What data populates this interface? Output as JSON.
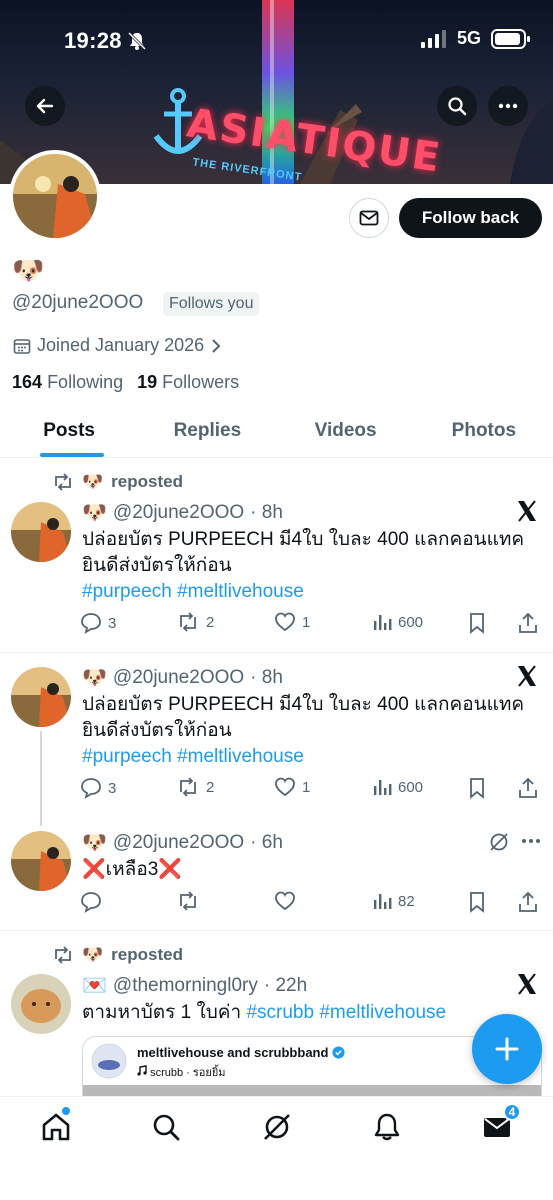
{
  "status_bar": {
    "time": "19:28",
    "network": "5G"
  },
  "banner": {
    "sign_text": "ASIATIQUE",
    "sign_subtext": "THE RIVERFRONT"
  },
  "profile": {
    "display_name": "🐶",
    "handle": "@20june2OOO",
    "follows_you": "Follows you",
    "joined": "Joined January 2026",
    "following_count": "164",
    "following_label": "Following",
    "followers_count": "19",
    "followers_label": "Followers",
    "follow_button": "Follow back"
  },
  "tabs": [
    {
      "label": "Posts",
      "active": true
    },
    {
      "label": "Replies",
      "active": false
    },
    {
      "label": "Videos",
      "active": false
    },
    {
      "label": "Photos",
      "active": false
    }
  ],
  "posts": [
    {
      "repost_label": "reposted",
      "repost_emoji": "🐶",
      "author_emoji": "🐶",
      "handle": "@20june2OOO",
      "time": "· 8h",
      "text_line1": "ปล่อยบัตร PURPEECH มี4ใบ ใบละ 400 แลกคอนแทค",
      "text_line2": "ยินดีส่งบัตรให้ก่อน",
      "hashtag1": "#purpeech",
      "hashtag2": "#meltlivehouse",
      "replies": "3",
      "reposts": "2",
      "likes": "1",
      "views": "600"
    },
    {
      "author_emoji": "🐶",
      "handle": "@20june2OOO",
      "time": "· 8h",
      "text_line1": "ปล่อยบัตร PURPEECH มี4ใบ ใบละ 400 แลกคอนแทค",
      "text_line2": "ยินดีส่งบัตรให้ก่อน",
      "hashtag1": "#purpeech",
      "hashtag2": "#meltlivehouse",
      "replies": "3",
      "reposts": "2",
      "likes": "1",
      "views": "600"
    },
    {
      "author_emoji": "🐶",
      "handle": "@20june2OOO",
      "time": "· 6h",
      "text": "❌เหลือ3❌",
      "views": "82"
    },
    {
      "repost_label": "reposted",
      "repost_emoji": "🐶",
      "author_emoji": "💌",
      "handle": "@themorningl0ry",
      "time": "· 22h",
      "text_prefix": "ตามหาบัตร 1 ใบค่า",
      "hashtag1": "#scrubb",
      "hashtag2": "#meltlivehouse",
      "embed_name": "meltlivehouse and scrubbband",
      "embed_sub": "scrubb · รอยยิ้ม"
    }
  ],
  "bottom_nav": {
    "messages_badge": "4"
  },
  "colors": {
    "accent": "#1d9bf0",
    "text": "#0f1419",
    "muted": "#536471",
    "border": "#eff3f4"
  }
}
